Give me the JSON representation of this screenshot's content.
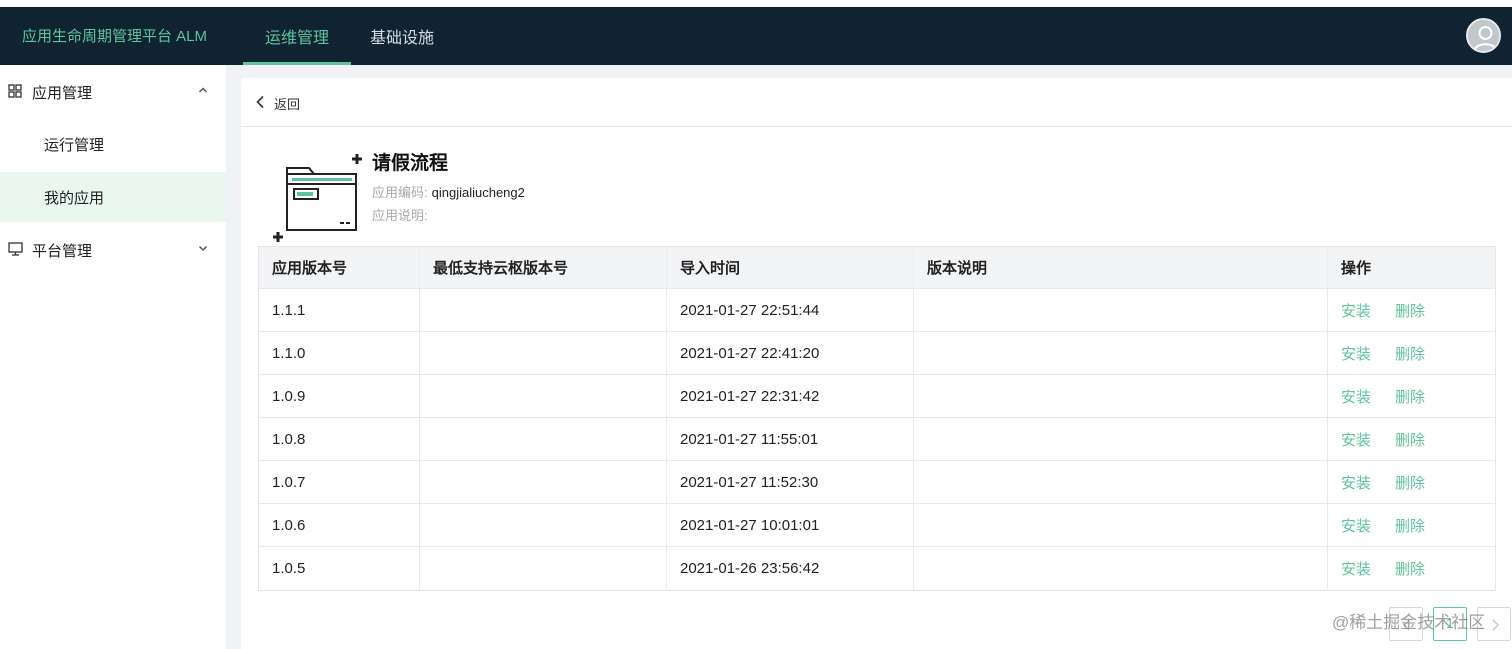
{
  "topbar": {
    "brand": "应用生命周期管理平台 ALM",
    "nav": [
      "运维管理",
      "基础设施"
    ],
    "active_nav": "运维管理"
  },
  "sidebar": {
    "groups": [
      {
        "label": "应用管理",
        "icon": "grid-icon",
        "expanded": true,
        "items": [
          {
            "label": "运行管理"
          },
          {
            "label": "我的应用",
            "selected": true
          }
        ]
      },
      {
        "label": "平台管理",
        "icon": "monitor-icon",
        "expanded": false,
        "items": []
      }
    ]
  },
  "main": {
    "back_label": "返回",
    "app": {
      "name": "请假流程",
      "code_label": "应用编码:",
      "code_value": "qingjialiucheng2",
      "desc_label": "应用说明:",
      "desc_value": ""
    },
    "table": {
      "columns": [
        "应用版本号",
        "最低支持云枢版本号",
        "导入时间",
        "版本说明",
        "操作"
      ],
      "rows": [
        {
          "version": "1.1.1",
          "min_version": "",
          "import_time": "2021-01-27 22:51:44",
          "notes": ""
        },
        {
          "version": "1.1.0",
          "min_version": "",
          "import_time": "2021-01-27 22:41:20",
          "notes": ""
        },
        {
          "version": "1.0.9",
          "min_version": "",
          "import_time": "2021-01-27 22:31:42",
          "notes": ""
        },
        {
          "version": "1.0.8",
          "min_version": "",
          "import_time": "2021-01-27 11:55:01",
          "notes": ""
        },
        {
          "version": "1.0.7",
          "min_version": "",
          "import_time": "2021-01-27 11:52:30",
          "notes": ""
        },
        {
          "version": "1.0.6",
          "min_version": "",
          "import_time": "2021-01-27 10:01:01",
          "notes": ""
        },
        {
          "version": "1.0.5",
          "min_version": "",
          "import_time": "2021-01-26 23:56:42",
          "notes": ""
        }
      ],
      "actions": [
        "安装",
        "删除"
      ]
    },
    "pagination": {
      "current_page": "1"
    }
  },
  "watermark": "@稀土掘金技术社区",
  "colors": {
    "accent": "#5fc39b",
    "topbar": "#0f2330",
    "selected_bg": "#eaf7f1"
  }
}
